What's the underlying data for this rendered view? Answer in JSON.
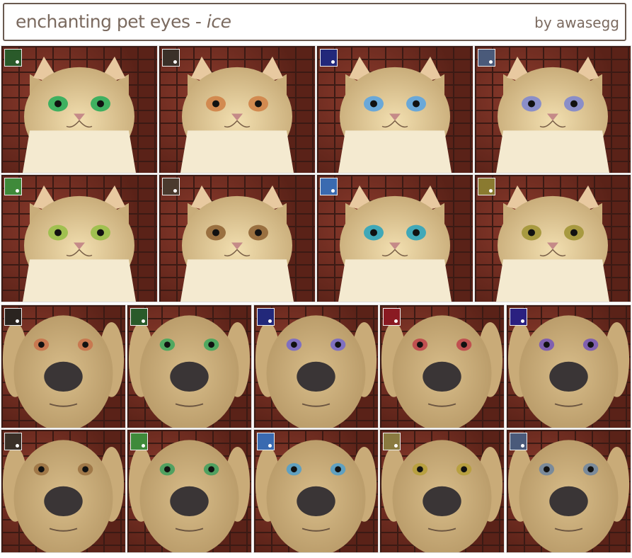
{
  "header": {
    "title": "enchanting pet eyes - ",
    "subtitle": "ice",
    "byline": "by awasegg"
  },
  "cats": [
    {
      "swatch": "#2a5a2a",
      "eye": "#3fb060"
    },
    {
      "swatch": "#3a3028",
      "eye": "#d28a50"
    },
    {
      "swatch": "#22287a",
      "eye": "#6aa8d8"
    },
    {
      "swatch": "#4a5a7a",
      "eye": "#8a8ec8"
    },
    {
      "swatch": "#3f8a3a",
      "eye": "#a0c050"
    },
    {
      "swatch": "#4a3a2e",
      "eye": "#9a7040"
    },
    {
      "swatch": "#3a6ab0",
      "eye": "#40a8b8"
    },
    {
      "swatch": "#8a7a30",
      "eye": "#a89a40"
    }
  ],
  "dogs": [
    {
      "swatch": "#2a2420",
      "eye": "#c87850"
    },
    {
      "swatch": "#2a5a2a",
      "eye": "#50a860"
    },
    {
      "swatch": "#22287a",
      "eye": "#8070c0"
    },
    {
      "swatch": "#8a1a22",
      "eye": "#c05050"
    },
    {
      "swatch": "#2a2080",
      "eye": "#8060b0"
    },
    {
      "swatch": "#3a3028",
      "eye": "#a07848"
    },
    {
      "swatch": "#3f8a3a",
      "eye": "#50a060"
    },
    {
      "swatch": "#3a6ab0",
      "eye": "#60a0c0"
    },
    {
      "swatch": "#8a7a40",
      "eye": "#b8a040"
    },
    {
      "swatch": "#4a5a7a",
      "eye": "#7a8a9a"
    }
  ]
}
